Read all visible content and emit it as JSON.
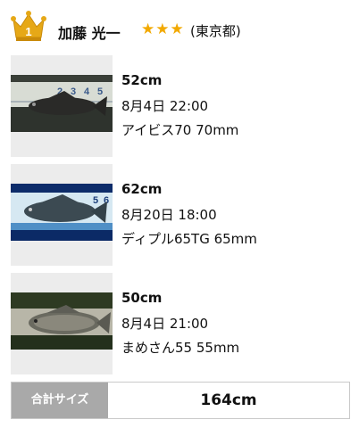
{
  "angler": {
    "rank": "1",
    "name": "加藤 光一",
    "stars": "★★★",
    "prefecture": "(東京都)"
  },
  "catches": [
    {
      "size": "52cm",
      "date": "8月4日 22:00",
      "lure": "アイビス70 70mm",
      "ruler_marks": [
        "2",
        "3",
        "4",
        "5"
      ]
    },
    {
      "size": "62cm",
      "date": "8月20日 18:00",
      "lure": "ディプル65TG 65mm",
      "ruler_marks": [
        "5",
        "6"
      ]
    },
    {
      "size": "50cm",
      "date": "8月4日 21:00",
      "lure": "まめさん55 55mm",
      "ruler_marks": []
    }
  ],
  "total": {
    "label": "合計サイズ",
    "value": "164cm"
  },
  "colors": {
    "crown": "#e6a817",
    "stars": "#f2a900",
    "total_label_bg": "#a9a9a9"
  }
}
